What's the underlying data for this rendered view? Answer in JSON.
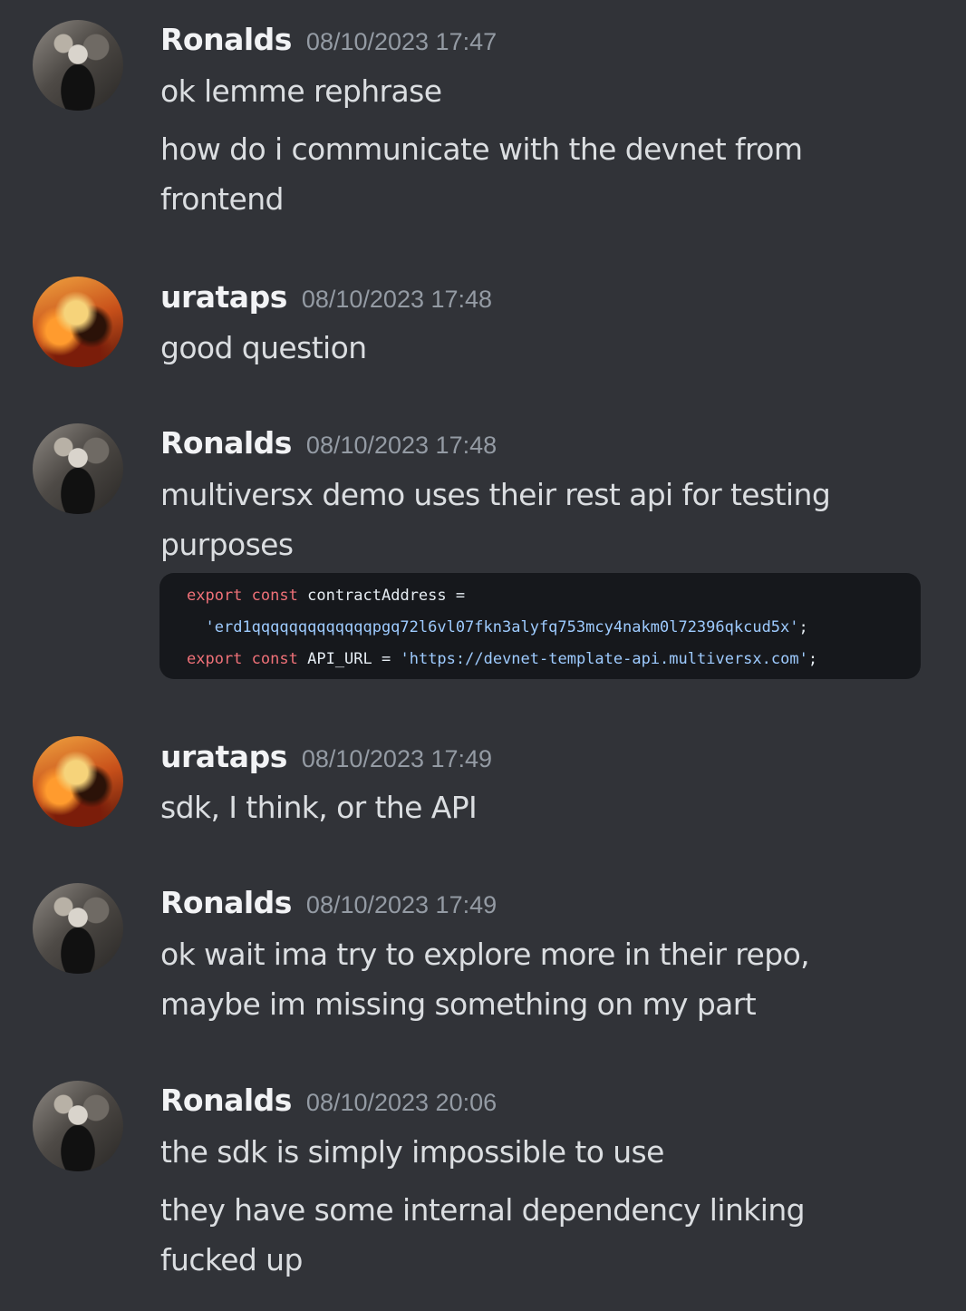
{
  "messages": [
    {
      "username": "Ronalds",
      "timestamp": "08/10/2023 17:47",
      "lines": [
        "ok lemme rephrase",
        "how do i communicate with the devnet from",
        "frontend"
      ]
    },
    {
      "username": "urataps",
      "timestamp": "08/10/2023 17:48",
      "lines": [
        "good question"
      ]
    },
    {
      "username": "Ronalds",
      "timestamp": "08/10/2023 17:48",
      "lines": [
        "multiversx demo uses their rest api for testing",
        "purposes"
      ],
      "code": {
        "line1_kw1": "export",
        "line1_kw2": "const",
        "line1_rest": "contractAddress =",
        "line2_str": "'erd1qqqqqqqqqqqqqpgq72l6vl07fkn3alyfq753mcy4nakm0l72396qkcud5x'",
        "line2_end": ";",
        "line3_kw1": "export",
        "line3_kw2": "const",
        "line3_rest": "API_URL =",
        "line3_str": "'https://devnet-template-api.multiversx.com'",
        "line3_end": ";"
      }
    },
    {
      "username": "urataps",
      "timestamp": "08/10/2023 17:49",
      "lines": [
        "sdk, I think, or the API"
      ]
    },
    {
      "username": "Ronalds",
      "timestamp": "08/10/2023 17:49",
      "lines": [
        "ok wait ima try to explore more in their repo,",
        "maybe im missing something on my part"
      ]
    },
    {
      "username": "Ronalds",
      "timestamp": "08/10/2023 20:06",
      "lines": [
        "the sdk is simply impossible to use",
        "they have some internal dependency linking",
        "fucked up"
      ]
    }
  ]
}
